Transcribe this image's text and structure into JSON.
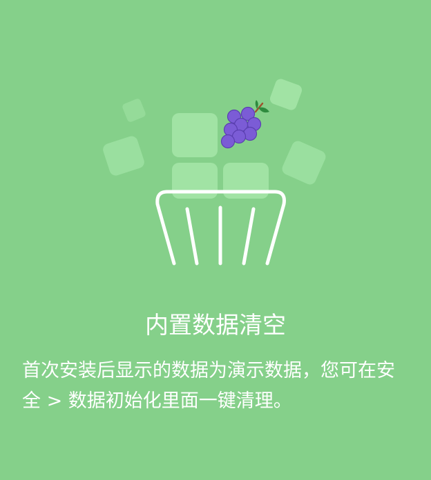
{
  "dialog": {
    "title": "内置数据清空",
    "description": "首次安装后显示的数据为演示数据，您可在安全 > 数据初始化里面一键清理。"
  },
  "colors": {
    "background": "#85d08a",
    "tile": "#a2e4a5",
    "basket_stroke": "#ffffff",
    "grape": "#7b5cd6",
    "grape_outline": "#5a3fb0",
    "leaf": "#2e8b3e"
  },
  "icons": {
    "illustration": "trash-basket-icon",
    "fruit": "grape-icon"
  }
}
